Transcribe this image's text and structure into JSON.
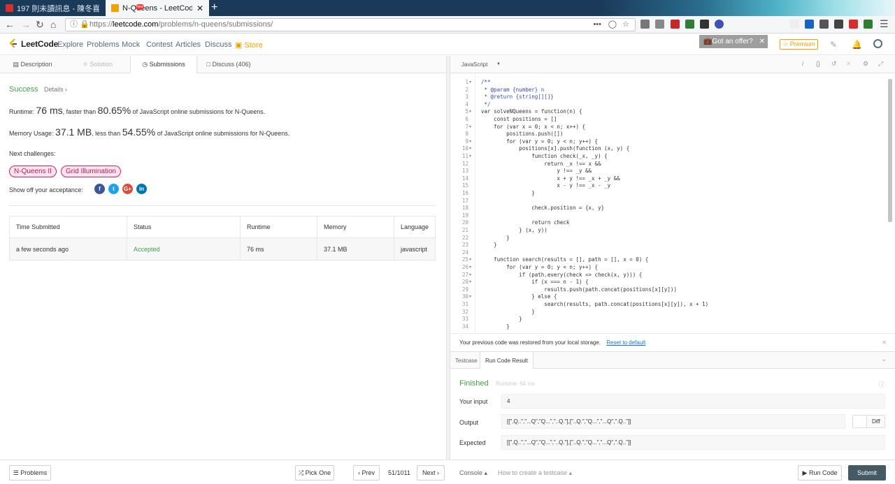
{
  "browser": {
    "tabs": [
      {
        "title": "197 則未讀訊息 - 陳冬喜 (mf",
        "icon_color": "#d93025"
      },
      {
        "title": "N-Queens - LeetCode",
        "icon_color": "#f0a202"
      }
    ],
    "new_tab": "+",
    "close_tab": "✕",
    "url_prefix": "https://",
    "url_host": "leetcode.com",
    "url_path": "/problems/n-queens/submissions/",
    "url_dots": "•••"
  },
  "header": {
    "logo": "LeetCode",
    "nav": [
      "Explore",
      "Problems",
      "Mock",
      "Contest",
      "Articles",
      "Discuss",
      "Store"
    ],
    "new_badge": "New",
    "offer": "Got an offer?",
    "premium": "Premium",
    "colors": {
      "store": "#f0a202",
      "accent": "#f0a202"
    }
  },
  "left_tabs": [
    {
      "label": "Description",
      "icon": "doc-icon"
    },
    {
      "label": "Solution",
      "icon": "flask-icon"
    },
    {
      "label": "Submissions",
      "icon": "clock-icon"
    },
    {
      "label": "Discuss (406)",
      "icon": "chat-icon"
    }
  ],
  "result": {
    "status": "Success",
    "details": "Details",
    "runtime_label": "Runtime: ",
    "runtime_value": "76 ms",
    "runtime_mid": ", faster than ",
    "runtime_pct": "80.65%",
    "runtime_tail": " of JavaScript online submissions for N-Queens.",
    "memory_label": "Memory Usage: ",
    "memory_value": "37.1 MB",
    "memory_mid": ", less than ",
    "memory_pct": "54.55%",
    "memory_tail": " of JavaScript online submissions for N-Queens.",
    "next_label": "Next challenges:",
    "challenges": [
      "N-Queens II",
      "Grid Illumination"
    ],
    "share_label": "Show off your acceptance:",
    "social": [
      "f",
      "t",
      "G+",
      "in"
    ]
  },
  "submissions_table": {
    "headers": [
      "Time Submitted",
      "Status",
      "Runtime",
      "Memory",
      "Language"
    ],
    "rows": [
      [
        "a few seconds ago",
        "Accepted",
        "76 ms",
        "37.1 MB",
        "javascript"
      ]
    ],
    "accepted_color": "#43a047"
  },
  "editor": {
    "language": "JavaScript",
    "lines": [
      "/**",
      " * @param {number} n",
      " * @return {string[][]}",
      " */",
      "var solveNQueens = function(n) {",
      "    const positions = []",
      "    for (var x = 0; x < n; x++) {",
      "        positions.push([])",
      "        for (var y = 0; y < n; y++) {",
      "            positions[x].push(function (x, y) {",
      "                function check(_x, _y) {",
      "                    return _x !== x &&",
      "                        y !== _y &&",
      "                        x + y !== _x + _y &&",
      "                        x - y !== _x - _y",
      "                }",
      "",
      "                check.position = {x, y}",
      "",
      "                return check",
      "            } (x, y))",
      "        }",
      "    }",
      "",
      "    function search(results = [], path = [], x = 0) {",
      "        for (var y = 0; y < n; y++) {",
      "            if (path.every(check => check(x, y))) {",
      "                if (x === n - 1) {",
      "                    results.push(path.concat(positions[x][y]))",
      "                } else {",
      "                    search(results, path.concat(positions[x][y]), x + 1)",
      "                }",
      "            }",
      "        }"
    ],
    "fold_lines": [
      1,
      5,
      7,
      9,
      10,
      11,
      25,
      26,
      27,
      28,
      30
    ]
  },
  "restore": {
    "message": "Your previous code was restored from your local storage.",
    "link": "Reset to default"
  },
  "run_result": {
    "tabs": [
      "Testcase",
      "Run Code Result"
    ],
    "status": "Finished",
    "runtime": "Runtime: 64 ms",
    "input_label": "Your input",
    "input_value": "4",
    "output_label": "Output",
    "output_value": "[[\".Q..\",\"...Q\",\"Q...\",\"..Q.\"],[\"..Q.\",\"Q...\",\"...Q\",\".Q..\"]]",
    "expected_label": "Expected",
    "expected_value": "[[\".Q..\",\"...Q\",\"Q...\",\"..Q.\"],[\"..Q.\",\"Q...\",\"...Q\",\".Q..\"]]",
    "diff_label": "Diff",
    "finished_color": "#43a047"
  },
  "bottom": {
    "problems": "Problems",
    "pick_one": "Pick One",
    "prev": "Prev",
    "page": "51/1011",
    "next": "Next",
    "console": "Console",
    "howto": "How to create a testcase",
    "run_code": "Run Code",
    "submit": "Submit"
  }
}
